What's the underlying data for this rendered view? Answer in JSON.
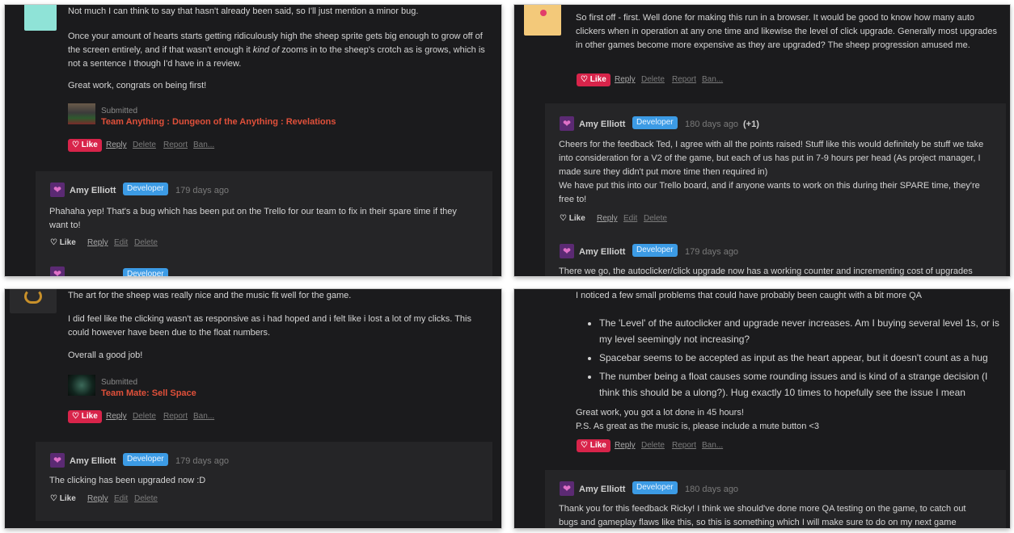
{
  "panel1": {
    "top_cut_line": "Not much I can think to say that hasn't already been said, so I'll just mention a minor bug.",
    "para1": "Once your amount of hearts starts getting ridiculously high the sheep sprite gets big enough to grow off of the screen entirely, and if that wasn't enough it ",
    "para1_em": "kind of",
    "para1_end": " zooms in to the sheep's crotch as is grows, which is not a sentence I though I'd have in a review.",
    "para2": "Great work, congrats on being first!",
    "submitted_label": "Submitted",
    "submitted_link": "Team Anything : Dungeon of the Anything : Revelations",
    "actions": {
      "like": "Like",
      "reply": "Reply",
      "delete": "Delete",
      "report": "Report",
      "ban": "Ban..."
    },
    "reply": {
      "author": "Amy Elliott",
      "badge": "Developer",
      "ago": "179 days ago",
      "text": "Phahaha yep! That's a bug which has been put on the Trello for our team to fix in their spare time if they want to!",
      "actions": {
        "like": "Like",
        "reply": "Reply",
        "edit": "Edit",
        "delete": "Delete"
      }
    }
  },
  "panel2": {
    "text": "So first off - first. Well done for making this run in a browser. It would be good to know how many auto clickers when in operation at any one time and likewise the level of click upgrade. Generally most upgrades in other games become more expensive as they are upgraded? The sheep progression amused me.",
    "actions": {
      "like": "Like",
      "reply": "Reply",
      "delete": "Delete",
      "report": "Report",
      "ban": "Ban..."
    },
    "reply1": {
      "author": "Amy Elliott",
      "badge": "Developer",
      "ago": "180 days ago",
      "votes": "(+1)",
      "text1": "Cheers for the feedback Ted, I agree with all the points raised! Stuff like this would definitely be stuff we take into consideration for a V2 of the game, but each of us has put in 7-9 hours per head (As project manager, I made sure they didn't put more time then required in)",
      "text2": "We have put this into our Trello board, and if anyone wants to work on this during their SPARE time, they're free to!",
      "actions": {
        "like": "Like",
        "reply": "Reply",
        "edit": "Edit",
        "delete": "Delete"
      }
    },
    "reply2": {
      "author": "Amy Elliott",
      "badge": "Developer",
      "ago": "179 days ago",
      "cut_text": "There we go, the autoclicker/click upgrade now has a working counter and incrementing cost of upgrades"
    }
  },
  "panel3": {
    "top_cut_line": "The art for the sheep was really nice and the music fit well for the game.",
    "para1": "I did feel like the clicking wasn't as responsive as i had hoped and i felt like i lost a lot of my clicks. This could however have been due to the float numbers.",
    "para2": "Overall a good job!",
    "submitted_label": "Submitted",
    "submitted_link": "Team Mate: Sell Space",
    "actions": {
      "like": "Like",
      "reply": "Reply",
      "delete": "Delete",
      "report": "Report",
      "ban": "Ban..."
    },
    "reply": {
      "author": "Amy Elliott",
      "badge": "Developer",
      "ago": "179 days ago",
      "text": "The clicking has been upgraded now :D",
      "actions": {
        "like": "Like",
        "reply": "Reply",
        "edit": "Edit",
        "delete": "Delete"
      }
    }
  },
  "panel4": {
    "top_cut_line": "I noticed a few small problems that could have probably been caught with a bit more QA",
    "bullets": [
      "The 'Level' of the autoclicker and upgrade never increases. Am I buying several level 1s, or is my level seemingly not increasing?",
      "Spacebar seems to be accepted as input as the heart appear, but it doesn't count as a hug",
      "The number being a float causes some rounding issues and is kind of a strange decision (I think this should be a ulong?). Hug exactly 10 times to hopefully see the issue I mean"
    ],
    "line1": "Great work, you got a lot done in 45 hours!",
    "line2": "P.S. As great as the music is, please include a mute button <3",
    "actions": {
      "like": "Like",
      "reply": "Reply",
      "delete": "Delete",
      "report": "Report",
      "ban": "Ban..."
    },
    "reply": {
      "author": "Amy Elliott",
      "badge": "Developer",
      "ago": "180 days ago",
      "text": "Thank you for this feedback Ricky! I think we should've done more QA testing on the game, to catch out bugs and gameplay flaws like this, so this is something which I will make sure to do on my next game"
    }
  }
}
